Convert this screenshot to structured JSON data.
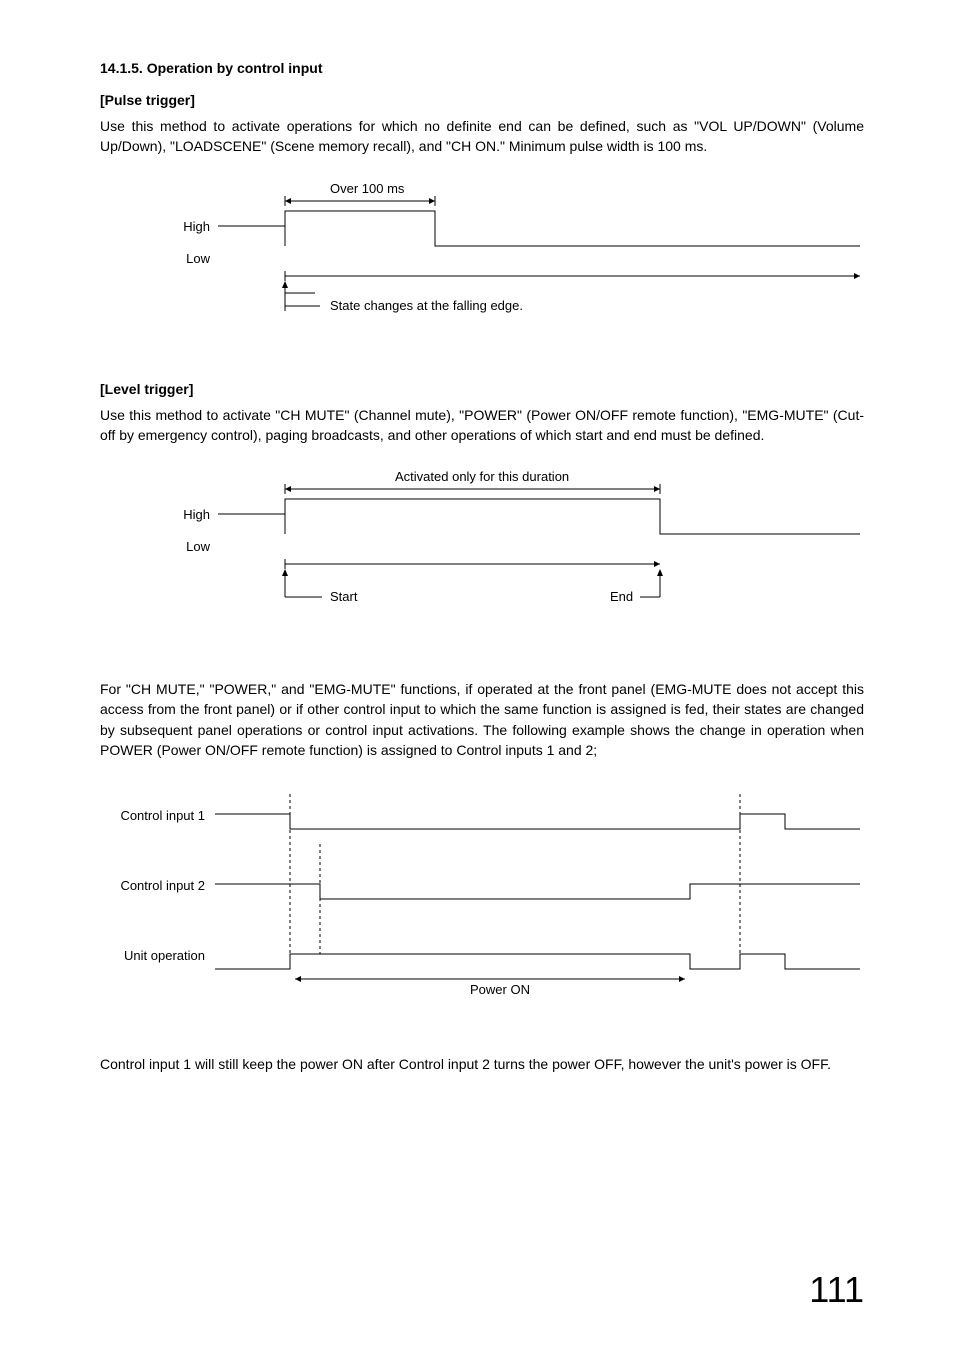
{
  "section": {
    "number": "14.1.5.",
    "title": "Operation by control input"
  },
  "pulse": {
    "heading": "[Pulse trigger]",
    "paragraph": "Use this method to activate operations for which no definite end can be defined, such as \"VOL UP/DOWN\" (Volume Up/Down), \"LOADSCENE\" (Scene memory recall), and \"CH ON.\" Minimum pulse width is 100 ms.",
    "pulse_width_label": "Over 100 ms",
    "high_label": "High",
    "low_label": "Low",
    "edge_note": "State changes at the falling edge."
  },
  "level": {
    "heading": "[Level trigger]",
    "paragraph": "Use this method to activate \"CH MUTE\" (Channel mute), \"POWER\" (Power ON/OFF remote function), \"EMG-MUTE\" (Cut-off by emergency control), paging broadcasts, and other operations of which start and end must be defined.",
    "duration_label": "Activated only for this duration",
    "high_label": "High",
    "low_label": "Low",
    "start_label": "Start",
    "end_label": "End"
  },
  "example": {
    "paragraph": "For \"CH MUTE,\" \"POWER,\" and \"EMG-MUTE\" functions, if operated at the front panel (EMG-MUTE does not accept this access from the front panel) or if other control input to which the same function is assigned is fed, their states are changed by subsequent panel operations or control input activations. The following example shows the change in operation when POWER (Power ON/OFF remote function) is assigned to Control inputs 1 and 2;",
    "ci1_label": "Control input 1",
    "ci2_label": "Control input 2",
    "unit_label": "Unit operation",
    "power_on_label": "Power ON",
    "closing_paragraph": "Control input 1 will still keep the power ON after Control input 2 turns the power OFF, however the unit's power is OFF."
  },
  "page_number": "111"
}
